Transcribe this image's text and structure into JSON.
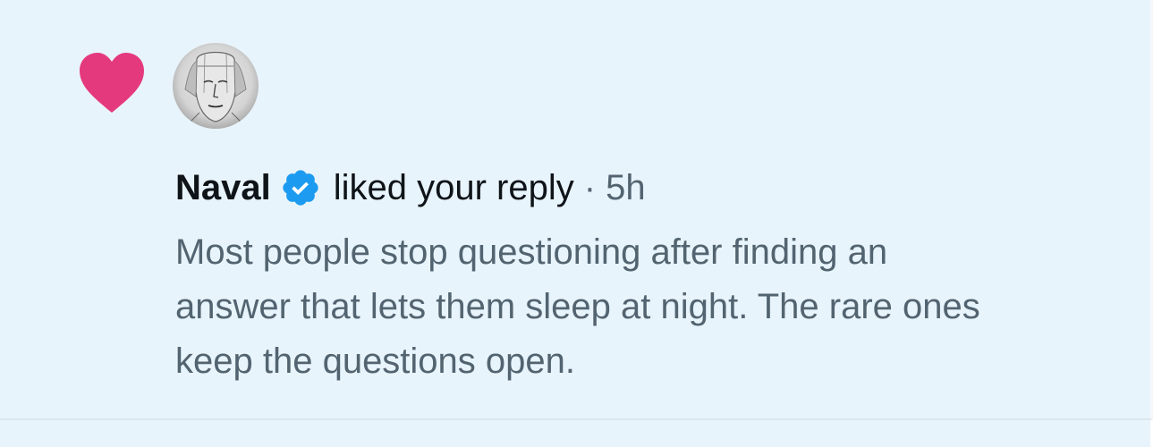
{
  "notification": {
    "user_name": "Naval",
    "action": "liked your reply",
    "separator": "·",
    "time": "5h",
    "reply_lines": [
      "Most people stop questioning after finding an",
      "answer that lets them sleep at night. The rare ones",
      "keep the questions open."
    ]
  },
  "icons": {
    "like": "heart-icon",
    "verified": "verified-badge-icon",
    "avatar": "sketch-portrait-avatar"
  },
  "colors": {
    "heart": "#e5397e",
    "verified": "#1d9bf0",
    "background": "#e8f4fb",
    "name_text": "#0f1419",
    "secondary_text": "#536471"
  }
}
